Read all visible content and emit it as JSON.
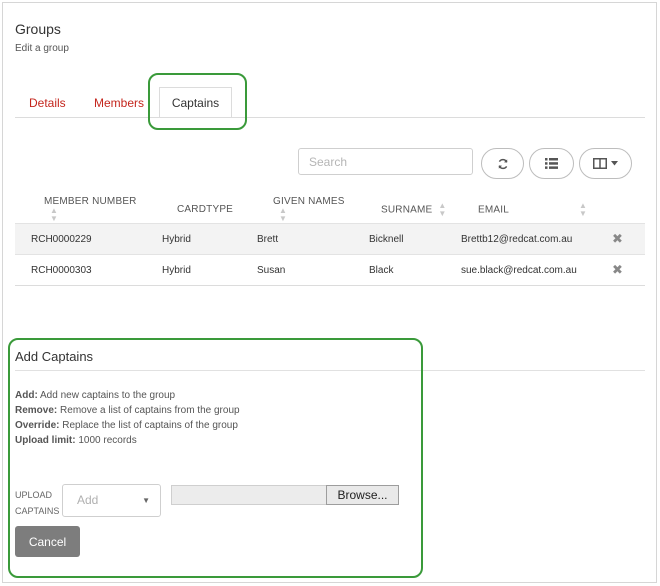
{
  "header": {
    "title": "Groups",
    "subtitle": "Edit a group"
  },
  "tabs": [
    {
      "label": "Details",
      "active": false
    },
    {
      "label": "Members",
      "active": false
    },
    {
      "label": "Captains",
      "active": true
    }
  ],
  "toolbar": {
    "search_placeholder": "Search",
    "buttons": [
      "refresh-icon",
      "list-view-icon",
      "columns-dropdown-icon"
    ]
  },
  "table": {
    "columns": [
      "MEMBER NUMBER",
      "CARDTYPE",
      "GIVEN NAMES",
      "SURNAME",
      "EMAIL"
    ],
    "rows": [
      {
        "member_number": "RCH0000229",
        "cardtype": "Hybrid",
        "given_names": "Brett",
        "surname": "Bicknell",
        "email": "Brettb12@redcat.com.au"
      },
      {
        "member_number": "RCH0000303",
        "cardtype": "Hybrid",
        "given_names": "Susan",
        "surname": "Black",
        "email": "sue.black@redcat.com.au"
      }
    ]
  },
  "add_captains": {
    "title": "Add Captains",
    "help": [
      {
        "term": "Add:",
        "text": "Add new captains to the group"
      },
      {
        "term": "Remove:",
        "text": "Remove a list of captains from the group"
      },
      {
        "term": "Override:",
        "text": "Replace the list of captains of the group"
      },
      {
        "term": "Upload limit:",
        "text": "1000 records"
      }
    ],
    "upload_label_1": "UPLOAD",
    "upload_label_2": "CAPTAINS",
    "mode_select_value": "Add",
    "browse_label": "Browse...",
    "cancel_label": "Cancel"
  },
  "colors": {
    "tab_link": "#c4261d",
    "highlight": "#3a9a3a",
    "cancel_bg": "#7d7d7d"
  }
}
